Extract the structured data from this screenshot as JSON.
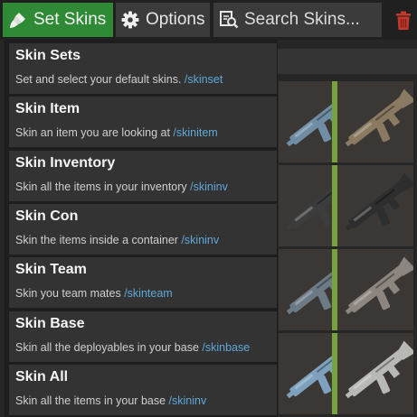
{
  "toolbar": {
    "set_skins_label": "Set Skins",
    "options_label": "Options",
    "search_placeholder": "Search Skins...",
    "accent_green": "#2f8a35",
    "trash_color": "#c0392b"
  },
  "icons": {
    "set_skins": "paintbrush-icon",
    "options": "gear-icon",
    "search": "search-icon",
    "delete": "trash-icon"
  },
  "menu": {
    "items": [
      {
        "title": "Skin Sets",
        "description": "Set and select your default skins. ",
        "command": "/skinset"
      },
      {
        "title": "Skin Item",
        "description": "Skin an item you are looking at ",
        "command": "/skinitem"
      },
      {
        "title": "Skin Inventory",
        "description": "Skin all the items in your inventory ",
        "command": "/skininv"
      },
      {
        "title": "Skin Con",
        "description": "Skin the items inside a container ",
        "command": "/skininv"
      },
      {
        "title": "Skin Team",
        "description": "Skin you team mates ",
        "command": "/skinteam"
      },
      {
        "title": "Skin Base",
        "description": "Skin all the deployables in your base ",
        "command": "/skinbase"
      },
      {
        "title": "Skin All",
        "description": "Skin all the items in your base ",
        "command": "/skininv"
      }
    ],
    "command_color": "#5fa8d8"
  },
  "skin_grid": {
    "tiles": [
      {
        "name": "blue-camo-rifle",
        "color": "#6f8ea6",
        "selected": false
      },
      {
        "name": "desert-rifle",
        "color": "#8a7a62",
        "selected": true
      },
      {
        "name": "dark-rifle",
        "color": "#3c3c3c",
        "selected": false
      },
      {
        "name": "black-rifle",
        "color": "#2e2e2e",
        "selected": true
      },
      {
        "name": "steel-rifle",
        "color": "#6c7a86",
        "selected": false
      },
      {
        "name": "stone-rifle",
        "color": "#8d8680",
        "selected": true
      },
      {
        "name": "ice-rifle",
        "color": "#7ea2bd",
        "selected": false
      },
      {
        "name": "white-rifle",
        "color": "#b8b8b4",
        "selected": true
      }
    ]
  }
}
